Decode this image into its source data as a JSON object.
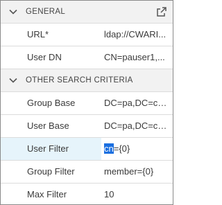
{
  "sections": [
    {
      "title": "GENERAL",
      "rows": [
        {
          "label": "URL*",
          "value": "ldap://CWARI..."
        },
        {
          "label": "User DN",
          "value": "CN=pauser1,..."
        }
      ]
    },
    {
      "title": "OTHER SEARCH CRITERIA",
      "rows": [
        {
          "label": "Group Base",
          "value": "DC=pa,DC=co..."
        },
        {
          "label": "User Base",
          "value": "DC=pa,DC=co..."
        },
        {
          "label": "User Filter",
          "value_selected": "cn",
          "value_rest": "={0}"
        },
        {
          "label": "Group Filter",
          "value": "member={0}"
        },
        {
          "label": "Max Filter",
          "value": "10"
        }
      ]
    }
  ],
  "icons": {
    "collapse": "chevron-down-icon",
    "popout": "external-link-icon"
  },
  "colors": {
    "header_bg": "#f2f2f2",
    "edit_row_bg": "#e6f4fb",
    "selection": "#1a6fe0"
  }
}
